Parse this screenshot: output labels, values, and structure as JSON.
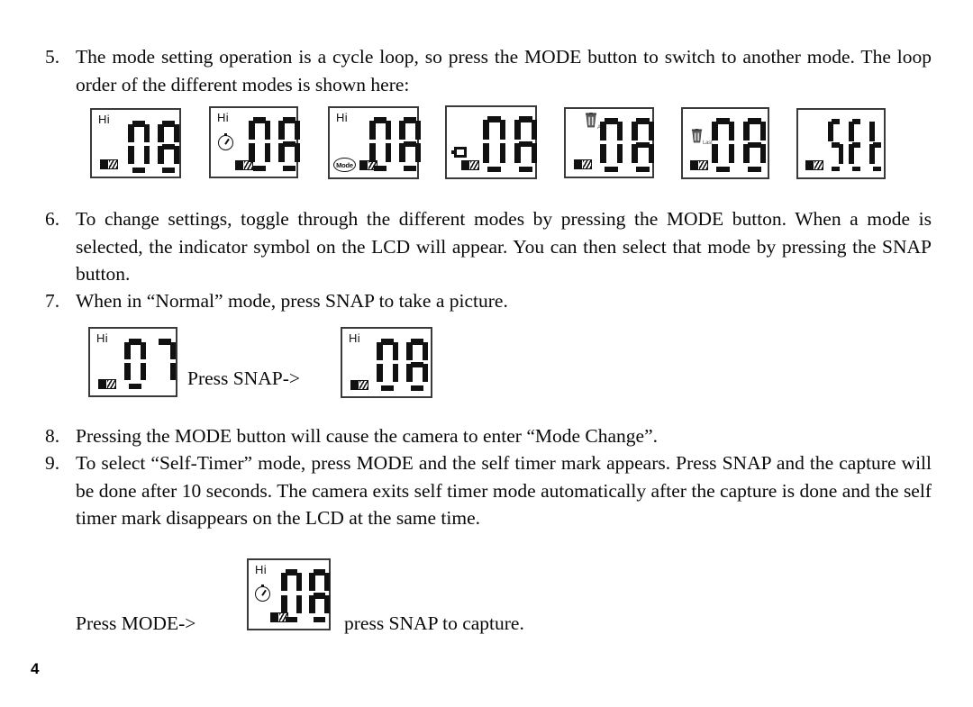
{
  "page": {
    "number": "4"
  },
  "items": [
    {
      "num": "5.",
      "text": "The mode setting operation is a cycle loop, so press the MODE button to switch to another mode. The loop order of the different modes is shown here:"
    },
    {
      "num": "6.",
      "text": "To change settings, toggle through the different modes by pressing the MODE button. When a mode is selected, the indicator symbol on the LCD will appear. You can then select that mode by pressing the SNAP button."
    },
    {
      "num": "7.",
      "text": "When in “Normal” mode, press SNAP to take a picture."
    },
    {
      "num": "8.",
      "text": "Pressing the MODE button will cause the camera to enter “Mode Change”."
    },
    {
      "num": "9.",
      "text": "To select “Self-Timer” mode, press MODE and the self timer mark appears. Press SNAP and the capture will be done after 10 seconds. The camera exits self timer mode automatically after the capture is done and the self timer mark disappears on the LCD at the same time."
    }
  ],
  "mode_loop": {
    "displays": [
      {
        "name": "lcd-normal",
        "hi": "Hi",
        "digits": "08",
        "icon": "none",
        "icon_label": "",
        "battery": true
      },
      {
        "name": "lcd-self-timer",
        "hi": "Hi",
        "digits": "08",
        "icon": "timer",
        "icon_label": "",
        "battery": true
      },
      {
        "name": "lcd-mode-change",
        "hi": "Hi",
        "digits": "08",
        "icon": "mode",
        "icon_label": "Mode",
        "battery": true
      },
      {
        "name": "lcd-video",
        "hi": "",
        "digits": "08",
        "icon": "video",
        "icon_label": "",
        "battery": true
      },
      {
        "name": "lcd-delete-all",
        "hi": "",
        "digits": "08",
        "icon": "trash",
        "icon_label": "ALL",
        "battery": true
      },
      {
        "name": "lcd-delete-last",
        "hi": "",
        "digits": "08",
        "icon": "trash",
        "icon_label": "Last",
        "battery": true
      },
      {
        "name": "lcd-set",
        "hi": "",
        "digits": "SEt",
        "icon": "none",
        "icon_label": "",
        "battery": true
      }
    ]
  },
  "snap_example": {
    "before": {
      "name": "lcd-count-07",
      "hi": "Hi",
      "digits": "07",
      "battery": true
    },
    "caption": "Press SNAP->",
    "after": {
      "name": "lcd-count-08",
      "hi": "Hi",
      "digits": "08",
      "battery": true
    }
  },
  "timer_example": {
    "caption_before": "Press MODE->",
    "display": {
      "name": "lcd-self-timer-08",
      "hi": "Hi",
      "digits": "08",
      "icon": "timer",
      "battery": true
    },
    "caption_after": "press SNAP to capture."
  },
  "colors": {
    "ink": "#0a0a0a",
    "lcd_border": "#3a3a3a",
    "segment": "#111111",
    "paper": "#ffffff"
  }
}
